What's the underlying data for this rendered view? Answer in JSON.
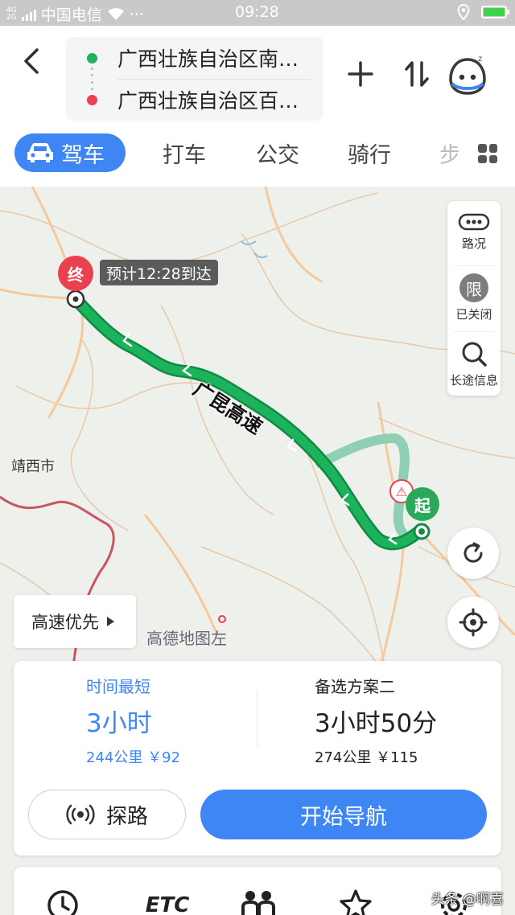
{
  "status_bar": {
    "network": "4G",
    "network2": "2G",
    "carrier": "中国电信",
    "dots": "···",
    "time": "09:28"
  },
  "header": {
    "origin": "广西壮族自治区南…",
    "destination": "广西壮族自治区百…",
    "colors": {
      "origin_dot": "#22b35a",
      "destination_dot": "#e9424e"
    }
  },
  "tabs": [
    {
      "label": "驾车",
      "icon": "car-icon",
      "active": true
    },
    {
      "label": "打车",
      "active": false
    },
    {
      "label": "公交",
      "active": false
    },
    {
      "label": "骑行",
      "active": false
    },
    {
      "label": "步",
      "active": false
    }
  ],
  "map": {
    "end_marker": "终",
    "start_marker": "起",
    "eta": "预计12:28到达",
    "road_label": "广昆高速",
    "place_label": "靖西市",
    "logo": "高德地图",
    "logo_suffix": "左",
    "route_color": "#1bb35c",
    "alt_route_color": "#8fcfb4"
  },
  "side_panel": {
    "traffic": "路况",
    "limit_char": "限",
    "limit_label": "已关闭",
    "long_info": "长途信息"
  },
  "preference": "高速优先",
  "plans": [
    {
      "name": "时间最短",
      "duration": "3小时",
      "meta": "244公里 ￥92",
      "selected": true,
      "color": "#3d86f4"
    },
    {
      "name": "备选方案二",
      "duration": "3小时50分",
      "meta": "274公里 ￥115",
      "selected": false,
      "color": "#222222"
    }
  ],
  "buttons": {
    "explore": "探路",
    "navigate": "开始导航"
  },
  "bottom": {
    "etc": "ETC"
  },
  "watermark": "头条 @啊喜"
}
